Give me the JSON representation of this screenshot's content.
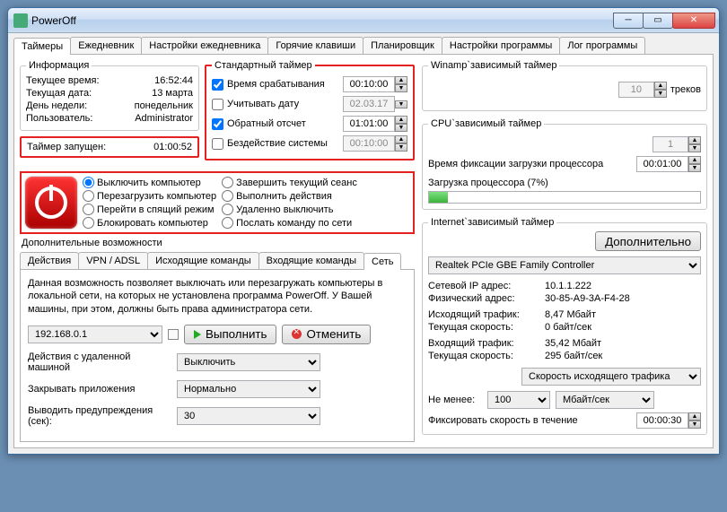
{
  "window": {
    "title": "PowerOff"
  },
  "main_tabs": [
    "Таймеры",
    "Ежедневник",
    "Настройки ежедневника",
    "Горячие клавиши",
    "Планировщик",
    "Настройки программы",
    "Лог программы"
  ],
  "info": {
    "legend": "Информация",
    "rows": [
      {
        "k": "Текущее время:",
        "v": "16:52:44"
      },
      {
        "k": "Текущая дата:",
        "v": "13 марта"
      },
      {
        "k": "День недели:",
        "v": "понедельник"
      },
      {
        "k": "Пользователь:",
        "v": "Administrator"
      }
    ],
    "timer_started_k": "Таймер запущен:",
    "timer_started_v": "01:00:52"
  },
  "std": {
    "legend": "Стандартный таймер",
    "rows": [
      {
        "label": "Время срабатывания",
        "checked": true,
        "value": "00:10:00",
        "enabled": true
      },
      {
        "label": "Учитывать дату",
        "checked": false,
        "value": "02.03.17",
        "enabled": false
      },
      {
        "label": "Обратный отсчет",
        "checked": true,
        "value": "01:01:00",
        "enabled": true
      },
      {
        "label": "Бездействие системы",
        "checked": false,
        "value": "00:10:00",
        "enabled": false
      }
    ]
  },
  "actions": {
    "col1": [
      "Выключить компьютер",
      "Перезагрузить компьютер",
      "Перейти в спящий режим",
      "Блокировать компьютер"
    ],
    "col2": [
      "Завершить текущий сеанс",
      "Выполнить действия",
      "Удаленно выключить",
      "Послать команду по сети"
    ]
  },
  "additional_label": "Дополнительные возможности",
  "sub_tabs": [
    "Действия",
    "VPN / ADSL",
    "Исходящие команды",
    "Входящие команды",
    "Сеть"
  ],
  "net": {
    "desc": "Данная возможность позволяет выключать или перезагружать компьютеры в локальной сети, на которых не установлена программа PowerOff. У Вашей машины, при этом, должны быть права администратора сети.",
    "ip": "192.168.0.1",
    "execute": "Выполнить",
    "cancel": "Отменить",
    "remote_action_label": "Действия с удаленной машиной",
    "remote_action_value": "Выключить",
    "close_apps_label": "Закрывать приложения",
    "close_apps_value": "Нормально",
    "warn_label": "Выводить предупреждения (сек):",
    "warn_value": "30"
  },
  "winamp": {
    "legend": "Winamp`зависимый таймер",
    "value": "10",
    "tracks": "треков"
  },
  "cpu": {
    "legend": "CPU`зависимый таймер",
    "threshold": "1",
    "fix_label": "Время фиксации загрузки процессора",
    "fix_value": "00:01:00",
    "load_label": "Загрузка процессора (7%)"
  },
  "inet": {
    "legend": "Internet`зависимый таймер",
    "more": "Дополнительно",
    "adapter": "Realtek PCIe GBE Family Controller",
    "kv": [
      {
        "k": "Сетевой IP адрес:",
        "v": "10.1.1.222"
      },
      {
        "k": "Физический адрес:",
        "v": "30-85-A9-3A-F4-28"
      },
      {
        "k": "Исходящий трафик:",
        "v": "8,47 Мбайт"
      },
      {
        "k": "Текущая скорость:",
        "v": "0 байт/сек"
      },
      {
        "k": "Входящий трафик:",
        "v": "35,42 Мбайт"
      },
      {
        "k": "Текущая скорость:",
        "v": "295 байт/сек"
      }
    ],
    "speed_select": "Скорость исходящего трафика",
    "atleast": "Не менее:",
    "min_value": "100",
    "unit": "Мбайт/сек",
    "fix_label": "Фиксировать скорость в течение",
    "fix_value": "00:00:30"
  }
}
